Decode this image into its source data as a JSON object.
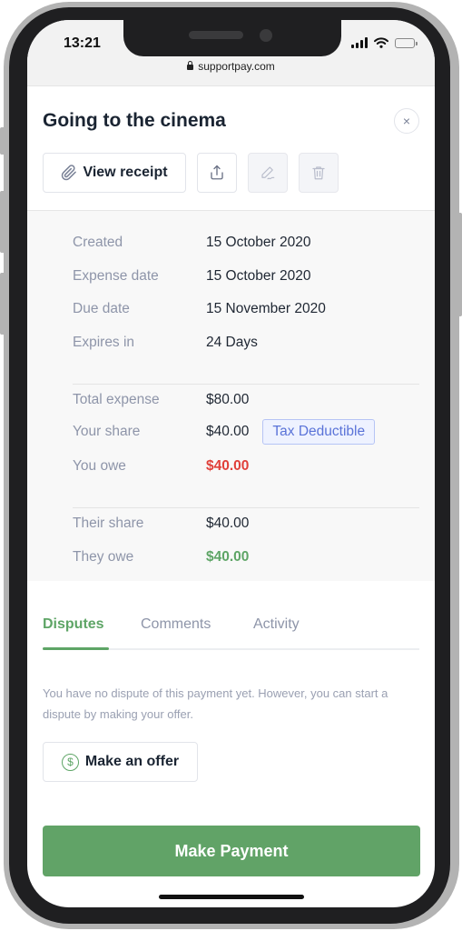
{
  "status_bar": {
    "time": "13:21",
    "url": "supportpay.com",
    "icons": [
      "signal-icon",
      "wifi-icon",
      "battery-icon"
    ]
  },
  "header": {
    "title": "Going to the cinema",
    "close_icon": "×"
  },
  "toolbar": {
    "view_receipt_label": "View receipt",
    "share_icon": "share-icon",
    "edit_icon": "edit-icon",
    "delete_icon": "trash-icon"
  },
  "dates": [
    {
      "label": "Created",
      "value": "15 October 2020"
    },
    {
      "label": "Expense date",
      "value": "15 October 2020"
    },
    {
      "label": "Due date",
      "value": "15 November 2020"
    },
    {
      "label": "Expires in",
      "value": "24 Days"
    }
  ],
  "amounts": [
    {
      "label": "Total expense",
      "value": "$80.00"
    },
    {
      "label": "Your share",
      "value": "$40.00",
      "badge": "Tax Deductible"
    },
    {
      "label": "You owe",
      "value": "$40.00"
    }
  ],
  "their_amounts": [
    {
      "label": "Their share",
      "value": "$40.00"
    },
    {
      "label": "They owe",
      "value": "$40.00"
    }
  ],
  "tabs": [
    {
      "label": "Disputes",
      "active": true
    },
    {
      "label": "Comments",
      "active": false
    },
    {
      "label": "Activity",
      "active": false
    }
  ],
  "disputes": {
    "message": "You have no dispute of this payment yet. However, you can start a dispute by making your offer.",
    "offer_button_label": "Make an offer",
    "offer_icon_glyph": "$"
  },
  "primary_action": {
    "label": "Make Payment"
  },
  "colors": {
    "accent_green": "#5ea566",
    "owe_red": "#e0403a",
    "badge_blue": "#5a73d8",
    "title_dark": "#1a2432"
  }
}
